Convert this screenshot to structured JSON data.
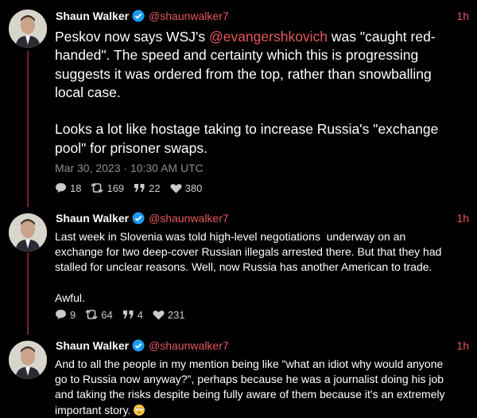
{
  "tweets": [
    {
      "name": "Shaun Walker",
      "handle": "@shaunwalker7",
      "time": "1h",
      "text_before": "Peskov now says WSJ's ",
      "mention": "@evangershkovich",
      "text_after": " was \"caught red-handed\". The speed and certainty which this is progressing suggests it was ordered from the top, rather than snowballing local case.\n\nLooks a lot like hostage taking to increase Russia's \"exchange pool\" for prisoner swaps.",
      "date": "Mar 30, 2023 · 10:30 AM UTC",
      "replies": "18",
      "retweets": "169",
      "quotes": "22",
      "likes": "380"
    },
    {
      "name": "Shaun Walker",
      "handle": "@shaunwalker7",
      "time": "1h",
      "text": "Last week in Slovenia was told high-level negotiations  underway on an exchange for two deep-cover Russian illegals arrested there. But that they had stalled for unclear reasons. Well, now Russia has another American to trade.\n\nAwful.",
      "replies": "9",
      "retweets": "64",
      "quotes": "4",
      "likes": "231"
    },
    {
      "name": "Shaun Walker",
      "handle": "@shaunwalker7",
      "time": "1h",
      "text": "And to all the people in my mention being like \"what an idiot why would anyone go to Russia now anyway?\", perhaps because he was a journalist doing his job and taking the risks despite being fully aware of them because it's an extremely important story. ",
      "emoji": "face-with-rolling-eyes"
    }
  ],
  "colors": {
    "accent": "#e8585b",
    "thread": "#7a1f2b",
    "verified": "#1d9bf0",
    "muted": "#8b8d91"
  }
}
